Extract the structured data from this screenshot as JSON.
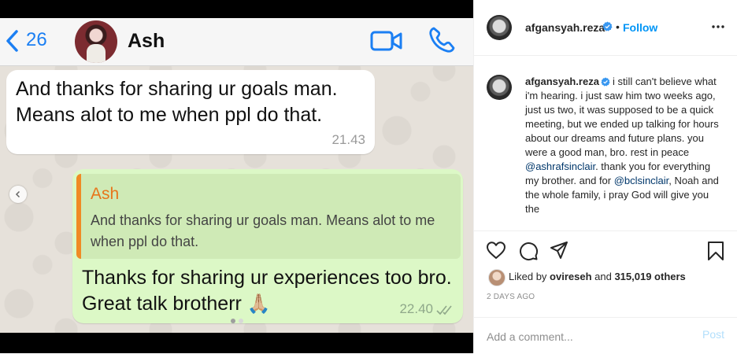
{
  "media": {
    "chat": {
      "back_count": "26",
      "contact_name": "Ash",
      "incoming": {
        "text": "And thanks for sharing ur goals man. Means alot to me when ppl do that.",
        "time": "21.43"
      },
      "outgoing": {
        "quote_name": "Ash",
        "quote_text": "And thanks for sharing ur goals man. Means alot to me when ppl do that.",
        "text": "Thanks for sharing ur experiences too bro. Great talk brotherr",
        "emoji": "🙏🏼",
        "time": "22.40"
      }
    },
    "colors": {
      "whatsapp_blue": "#1b7ff3",
      "quote_orange": "#f08a24",
      "outgoing_bubble": "#dcf8c6"
    }
  },
  "post": {
    "header": {
      "username": "afgansyah.reza",
      "bullet": "•",
      "follow_label": "Follow"
    },
    "caption": {
      "username": "afgansyah.reza",
      "text_1": "i still can't believe what i'm hearing. i just saw him two weeks ago, just us two, it was supposed to be a quick meeting, but we ended up talking for hours about our dreams and future plans. you were a good man, bro. rest in peace ",
      "mention_1": "@ashrafsinclair",
      "text_2": ". thank you for everything my brother. and for ",
      "mention_2": "@bclsinclair",
      "text_3": ", Noah and the whole family, i pray God will give you the"
    },
    "likes": {
      "prefix": "Liked by ",
      "user": "ovireseh",
      "middle": " and ",
      "count": "315,019 others"
    },
    "date": "2 DAYS AGO",
    "comment": {
      "placeholder": "Add a comment...",
      "post_label": "Post"
    },
    "colors": {
      "link_blue": "#0095f6",
      "verified_blue": "#3897f0"
    }
  }
}
